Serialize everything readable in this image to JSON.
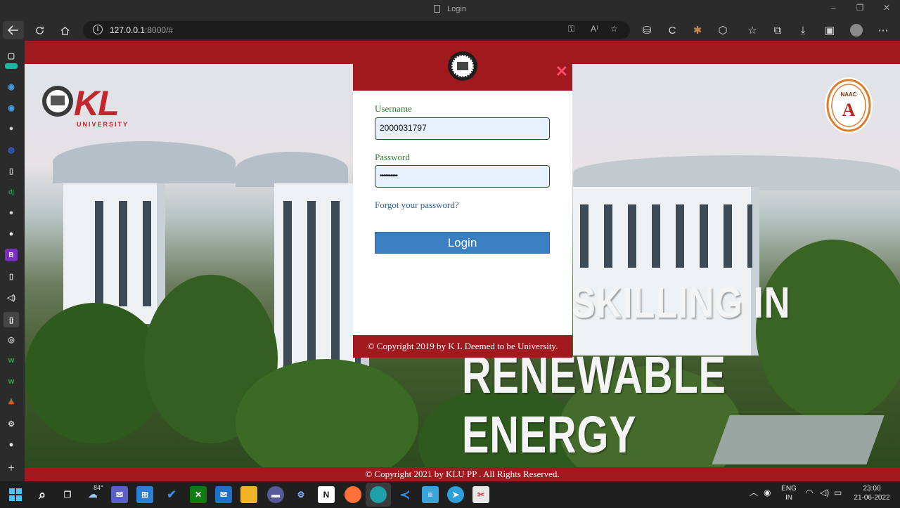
{
  "window": {
    "title": "Login",
    "minimize": "–",
    "maximize": "❐",
    "close": "✕"
  },
  "browser": {
    "url_host": "127.0.0.1",
    "url_rest": ":8000/#"
  },
  "page": {
    "top_band_text": "",
    "bg_text_line1": "SKILLING IN",
    "bg_text_line2": "RENEWABLE ENERGY",
    "kl_logo_text": "KL",
    "kl_logo_sub": "UNIVERSITY",
    "naac_text": "NAAC",
    "naac_grade": "A",
    "footer": "© Copyright 2021 by KLU PP . All Rights Reserved."
  },
  "login": {
    "close_symbol": "✕",
    "username_label": "Username",
    "username_value": "2000031797",
    "password_label": "Password",
    "password_value": "••••••••••",
    "forgot": "Forgot your password?",
    "button": "Login",
    "footer": "© Copyright 2019 by K L Deemed to be University."
  },
  "taskbar": {
    "weather": "84°",
    "lang_top": "ENG",
    "lang_bottom": "IN",
    "time": "23:00",
    "date": "21-06-2022"
  },
  "colors": {
    "brand_red": "#a0191f",
    "button_blue": "#3a7fc1",
    "label_green": "#2e7d32",
    "link_blue": "#2a6496"
  }
}
